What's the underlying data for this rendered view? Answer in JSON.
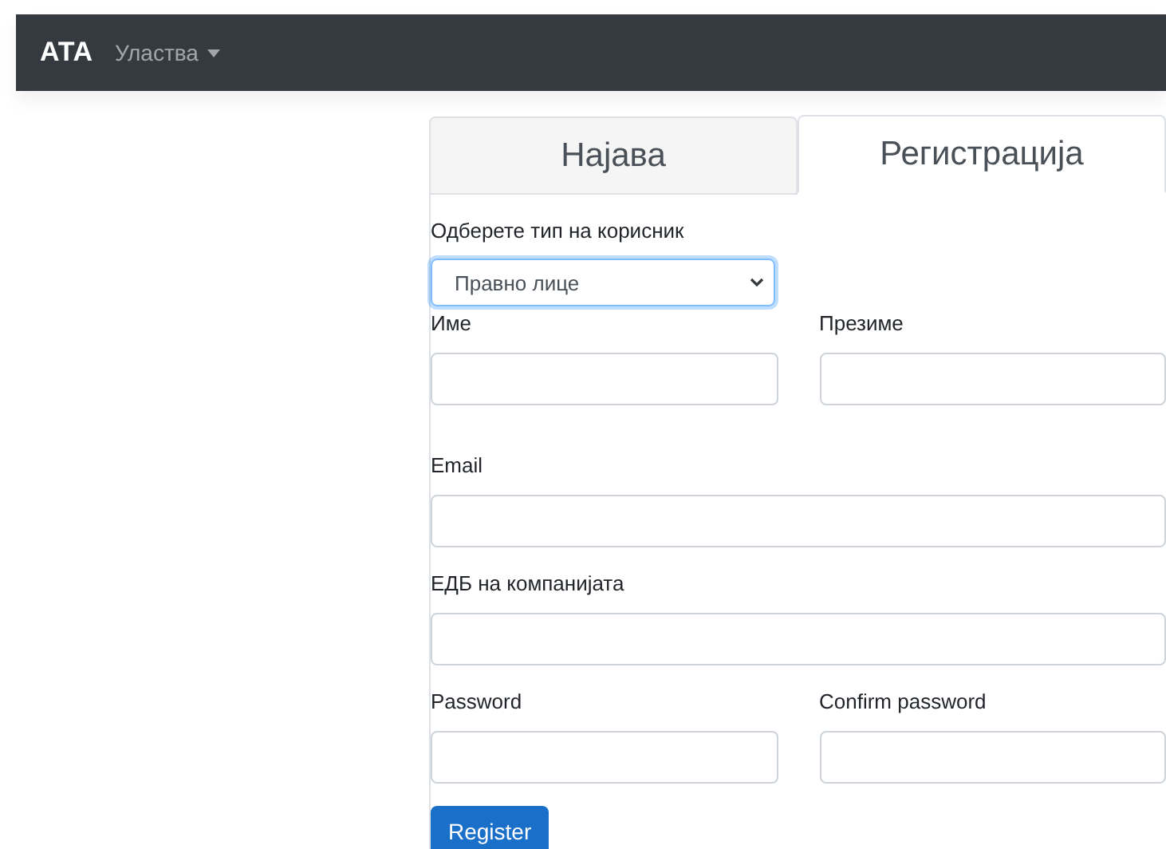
{
  "navbar": {
    "brand": "АТА",
    "menu": {
      "label": "Уластва"
    }
  },
  "tabs": [
    {
      "label": "Најава",
      "selected": false
    },
    {
      "label": "Регистрација",
      "selected": true
    }
  ],
  "form": {
    "user_type": {
      "label": "Одберете тип на корисник",
      "value": "Правно лице"
    },
    "rows": [
      {
        "fields": [
          {
            "label": "Име"
          },
          {
            "label": "Презиме"
          }
        ]
      },
      {
        "fields": [
          {
            "label": "Email"
          }
        ]
      },
      {
        "fields": [
          {
            "label": "ЕДБ на компанијата"
          }
        ]
      },
      {
        "fields": [
          {
            "label": "Password"
          },
          {
            "label": "Confirm password"
          }
        ]
      }
    ],
    "submit": "Register"
  }
}
